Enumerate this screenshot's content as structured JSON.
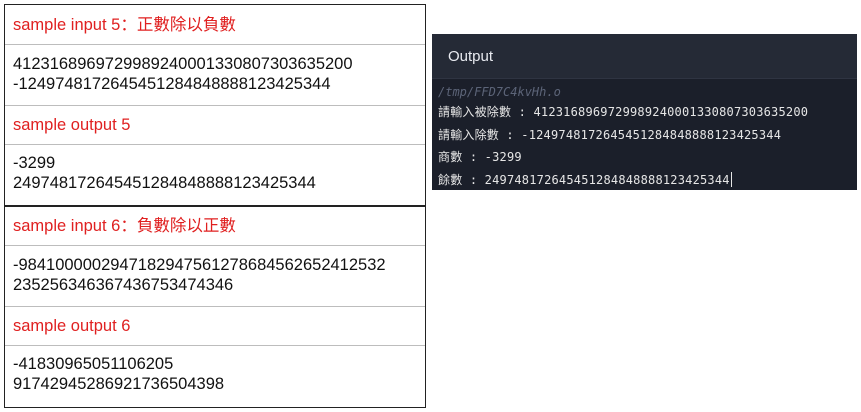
{
  "samples": {
    "group1": {
      "input_label": "sample input 5：正數除以負數",
      "input_lines": [
        "412316896972998924000133080730363520​0",
        "-1249748172645451284848888123425344"
      ],
      "output_label": "sample output 5",
      "output_lines": [
        "-3299",
        "2497481726454512848488881234253​44"
      ]
    },
    "group2": {
      "input_label": "sample input 6：負數除以正數",
      "input_lines": [
        "-98410000029471829475612786845626524125​32",
        "235256346367436753474346"
      ],
      "output_label": "sample output 6",
      "output_lines": [
        "-41830965051106205",
        "91742945286921736504398"
      ]
    }
  },
  "output_panel": {
    "title": "Output",
    "path": "/tmp/FFD7C4kvHh.o",
    "lines": [
      "請輸入被除數 : 4123168969729989240001330807303635200",
      "請輸入除數 : -1249748172645451284848888123425344",
      "商數 : -3299",
      "餘數 : 2497481726454512848488881234253​44"
    ]
  }
}
